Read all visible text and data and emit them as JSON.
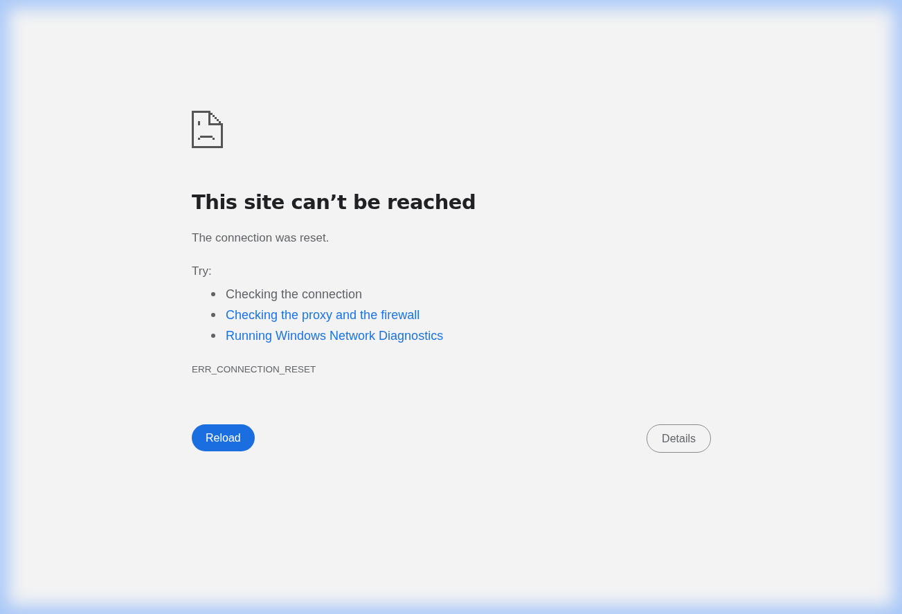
{
  "heading": "This site can’t be reached",
  "message": "The connection was reset.",
  "try_label": "Try:",
  "suggestions": [
    {
      "kind": "text",
      "text": "Checking the connection"
    },
    {
      "kind": "link",
      "text": "Checking the proxy and the firewall"
    },
    {
      "kind": "link",
      "text": "Running Windows Network Diagnostics"
    }
  ],
  "error_code": "ERR_CONNECTION_RESET",
  "buttons": {
    "reload": "Reload",
    "details": "Details"
  }
}
